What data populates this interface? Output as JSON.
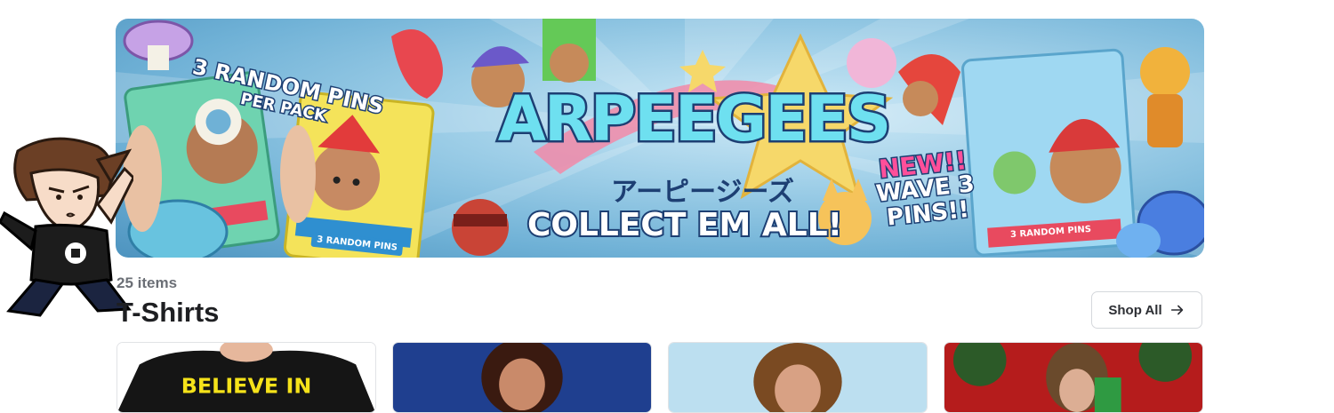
{
  "banner": {
    "wordmark": "ARPEEGEES",
    "japanese": "アーピージーズ",
    "tagline": "COLLECT EM ALL!",
    "random_line1": "3 RANDOM PINS",
    "random_line2": "PER PACK",
    "badge_new": "NEW!!",
    "badge_wave": "WAVE 3",
    "badge_pins": "PINS!!",
    "pack_label": "3 RANDOM PINS"
  },
  "section": {
    "item_count": "25 items",
    "title": "T-Shirts",
    "shop_all_label": "Shop All",
    "shop_all_icon": "arrow-right-icon"
  },
  "products": [
    {
      "name": "product-card-1",
      "shirt_text": "BELIEVE IN"
    },
    {
      "name": "product-card-2"
    },
    {
      "name": "product-card-3"
    },
    {
      "name": "product-card-4"
    }
  ],
  "colors": {
    "banner_blue": "#6fb1d6",
    "wordmark_fill": "#6ee0f0",
    "outline_navy": "#1d3f73",
    "accent_pink": "#ff4f9a",
    "text_dark": "#1e1f22",
    "text_muted": "#6b6f76"
  }
}
